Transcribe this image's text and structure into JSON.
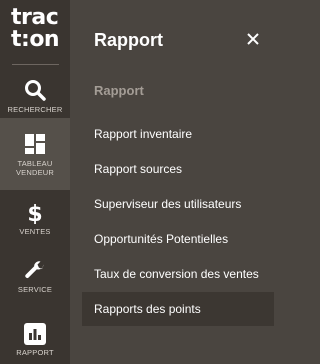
{
  "logo": {
    "line1": "trac",
    "line2": "t:on"
  },
  "rail": {
    "search_label": "RECHERCHER",
    "tableau_label_1": "TABLEAU",
    "tableau_label_2": "VENDEUR",
    "ventes_label": "VENTES",
    "service_label": "SERVICE",
    "rapport_label": "RAPPORT"
  },
  "panel": {
    "title": "Rapport",
    "close": "✕",
    "section": "Rapport",
    "items": [
      "Rapport inventaire",
      "Rapport sources",
      "Superviseur des utilisateurs",
      "Opportunités Potentielles",
      "Taux de conversion des ventes",
      "Rapports des points"
    ]
  },
  "colors": {
    "rail_bg": "#3a3530",
    "panel_bg": "#4a4540",
    "active_tile": "#55504a",
    "selected_item": "#3c3732",
    "section_text": "#a49d96"
  }
}
